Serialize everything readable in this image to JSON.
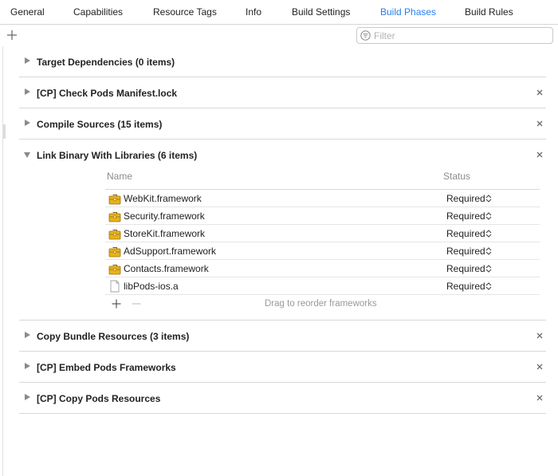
{
  "tabs": [
    {
      "label": "General",
      "active": false
    },
    {
      "label": "Capabilities",
      "active": false
    },
    {
      "label": "Resource Tags",
      "active": false
    },
    {
      "label": "Info",
      "active": false
    },
    {
      "label": "Build Settings",
      "active": false
    },
    {
      "label": "Build Phases",
      "active": true
    },
    {
      "label": "Build Rules",
      "active": false
    }
  ],
  "filter": {
    "placeholder": "Filter"
  },
  "phases": [
    {
      "title": "Target Dependencies (0 items)",
      "expanded": false,
      "removable": false
    },
    {
      "title": "[CP] Check Pods Manifest.lock",
      "expanded": false,
      "removable": true
    },
    {
      "title": "Compile Sources (15 items)",
      "expanded": false,
      "removable": true
    },
    {
      "title": "Link Binary With Libraries (6 items)",
      "expanded": true,
      "removable": true
    },
    {
      "title": "Copy Bundle Resources (3 items)",
      "expanded": false,
      "removable": true
    },
    {
      "title": "[CP] Embed Pods Frameworks",
      "expanded": false,
      "removable": true
    },
    {
      "title": "[CP] Copy Pods Resources",
      "expanded": false,
      "removable": true
    }
  ],
  "libraries": {
    "header_name": "Name",
    "header_status": "Status",
    "items": [
      {
        "name": "WebKit.framework",
        "status": "Required",
        "icon": "framework-toolbox-icon"
      },
      {
        "name": "Security.framework",
        "status": "Required",
        "icon": "framework-toolbox-icon"
      },
      {
        "name": "StoreKit.framework",
        "status": "Required",
        "icon": "framework-toolbox-icon"
      },
      {
        "name": "AdSupport.framework",
        "status": "Required",
        "icon": "framework-toolbox-icon"
      },
      {
        "name": "Contacts.framework",
        "status": "Required",
        "icon": "framework-toolbox-icon"
      },
      {
        "name": "libPods-ios.a",
        "status": "Required",
        "icon": "document-file-icon"
      }
    ],
    "footer_hint": "Drag to reorder frameworks"
  },
  "colors": {
    "accent": "#2a7ff0",
    "framework_icon": "#e8b21a"
  }
}
